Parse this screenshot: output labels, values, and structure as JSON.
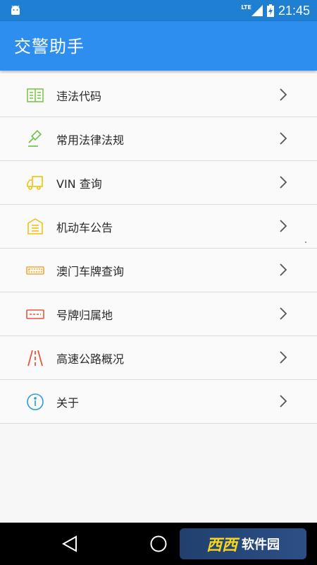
{
  "status_bar": {
    "network_label": "LTE",
    "time": "21:45"
  },
  "app_bar": {
    "title": "交警助手"
  },
  "menu": {
    "items": [
      {
        "label": "违法代码",
        "icon": "book-icon",
        "color": "#7cc84a"
      },
      {
        "label": "常用法律法规",
        "icon": "gavel-icon",
        "color": "#6dbf45"
      },
      {
        "label": "VIN 查询",
        "icon": "truck-icon",
        "color": "#f2c20f"
      },
      {
        "label": "机动车公告",
        "icon": "notice-icon",
        "color": "#f2c20f"
      },
      {
        "label": "澳门车牌查询",
        "icon": "plate-icon",
        "color": "#f0a93a"
      },
      {
        "label": "号牌归属地",
        "icon": "plate-outline-icon",
        "color": "#e8553f"
      },
      {
        "label": "高速公路概况",
        "icon": "highway-icon",
        "color": "#e8553f"
      },
      {
        "label": "关于",
        "icon": "info-icon",
        "color": "#2c9bd8"
      }
    ]
  },
  "nav_bar": {
    "watermark_logo": "西西",
    "watermark_text": "软件园"
  }
}
